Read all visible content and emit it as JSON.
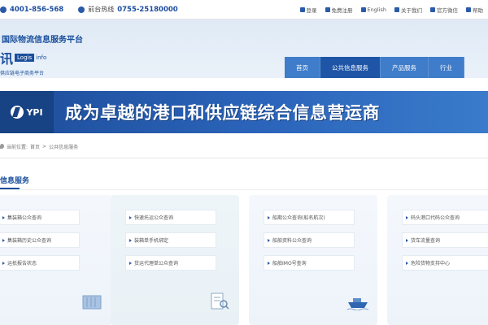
{
  "topbar": {
    "phone1": "4001-856-568",
    "phone2_label": "前台热线",
    "phone2": "0755-25180000",
    "links": [
      {
        "label": "登录",
        "icon": "user-icon"
      },
      {
        "label": "免费注册",
        "icon": "register-icon"
      },
      {
        "label": "English",
        "icon": "globe-icon"
      },
      {
        "label": "关于我们",
        "icon": "info-icon"
      },
      {
        "label": "官方微信",
        "icon": "wechat-icon"
      },
      {
        "label": "帮助",
        "icon": "help-icon"
      }
    ]
  },
  "brand": {
    "title": "国际物流信息服务平台",
    "name": "讯",
    "tag": "Logis",
    "suffix": "info",
    "subtitle": "供应链电子商务平台"
  },
  "nav": [
    {
      "label": "首页",
      "active": false
    },
    {
      "label": "公共信息服务",
      "active": true
    },
    {
      "label": "产品服务",
      "active": false
    },
    {
      "label": "行业",
      "active": false
    }
  ],
  "banner": {
    "logo_text": "YPI",
    "slogan": "成为卓越的港口和供应链综合信息营运商"
  },
  "breadcrumb": {
    "prefix": "当前位置:",
    "home": "首页",
    "sep": ">",
    "current": "公共信息服务"
  },
  "section": {
    "title": "信息服务"
  },
  "cards": [
    {
      "entries": [
        "集装箱公众查询",
        "集装箱历史公众查询",
        "运抵报告状态"
      ],
      "deco": "container-icon"
    },
    {
      "entries": [
        "快速托运公众查询",
        "装箱单手机绑定",
        "货运代理单公众查询"
      ],
      "deco": "document-search-icon"
    },
    {
      "entries": [
        "船期公众查询(船名航次)",
        "船舶资料公众查询",
        "船舶IMO号查询"
      ],
      "deco": "ship-icon"
    },
    {
      "entries": [
        "码头港口代码公众查询",
        "货车流量查询",
        "危险货物支持中心"
      ],
      "deco": "truck-icon"
    }
  ],
  "colors": {
    "brand": "#1a4f9c",
    "nav": "#3f7cc9",
    "nav_active": "#1e55a6",
    "banner": "#2b65bb"
  }
}
